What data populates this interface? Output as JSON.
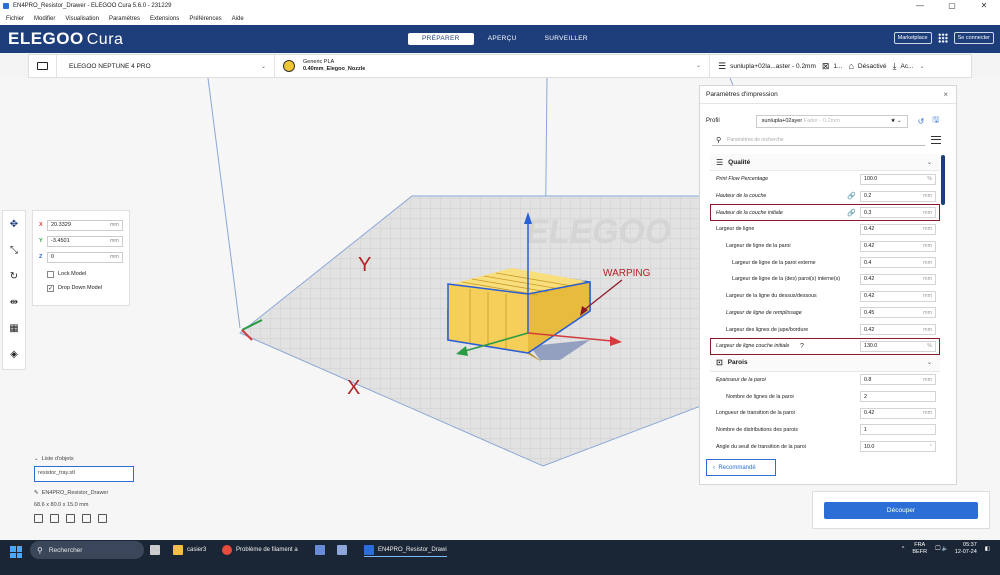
{
  "window": {
    "title": "EN4PRO_Resistor_Drawer - ELEGOO Cura 5.6.0 - 231229",
    "controls": [
      "—",
      "▢",
      "✕"
    ]
  },
  "menu": [
    "Fichier",
    "Modifier",
    "Visualisation",
    "Paramètres",
    "Extensions",
    "Préférences",
    "Aide"
  ],
  "header": {
    "logo": "ELEGOO",
    "logo_product": "Cura",
    "tabs": [
      "PRÉPARER",
      "APERÇU",
      "SURVEILLER"
    ],
    "marketplace": "Marketplace",
    "login": "Se connecter"
  },
  "toolbar": {
    "printer": "ELEGOO NEPTUNE 4 PRO",
    "material_line1": "Generic PLA",
    "material_line2": "0.40mm_Elegoo_Nozzle",
    "profile_summary": "sunlupla+02la...aster - 0.2mm",
    "support_value": "1...",
    "adhesion_label": "Désactivé",
    "extra_label": "Ac..."
  },
  "viewport": {
    "axis_x": "X",
    "axis_y": "Y",
    "brand_watermark": "ELEGOO",
    "warping_label": "WARPING"
  },
  "move_panel": {
    "x": "20.3329",
    "y": "-3.4501",
    "z": "0",
    "unit": "mm",
    "lock_model": "Lock Model",
    "drop_down": "Drop Down Model",
    "drop_down_checked": true,
    "lock_checked": false
  },
  "objects": {
    "header": "Liste d'objets",
    "file": "resistor_tray.stl",
    "project": "EN4PRO_Resistor_Drawer",
    "dimensions": "68.6 x 80.0 x 15.0 mm"
  },
  "settings": {
    "title": "Paramètres d'impression",
    "profile_label": "Profil",
    "profile_value": "sunlupla+02ayer",
    "profile_muted": "Fader - 0.2mm",
    "search_placeholder": "Paramètres de recherche",
    "quality_section": "Qualité",
    "walls_section": "Parois",
    "rows": [
      {
        "label": "Print Flow Percentage",
        "value": "100.0",
        "unit": "%",
        "italic": true,
        "level": 0
      },
      {
        "label": "Hauteur de la couche",
        "value": "0.2",
        "unit": "mm",
        "italic": true,
        "level": 0,
        "link": true
      },
      {
        "label": "Hauteur de la couche initiale",
        "value": "0.3",
        "unit": "mm",
        "italic": true,
        "level": 0,
        "link": true,
        "highlight": true
      },
      {
        "label": "Largeur de ligne",
        "value": "0.42",
        "unit": "mm",
        "italic": false,
        "level": 0
      },
      {
        "label": "Largeur de ligne de la paroi",
        "value": "0.42",
        "unit": "mm",
        "italic": false,
        "level": 1
      },
      {
        "label": "Largeur de ligne de la paroi externe",
        "value": "0.4",
        "unit": "mm",
        "italic": false,
        "level": 2
      },
      {
        "label": "Largeur de ligne de la (des) paroi(s) interne(s)",
        "value": "0.42",
        "unit": "mm",
        "italic": false,
        "level": 2
      },
      {
        "label": "Largeur de la ligne du dessus/dessous",
        "value": "0.42",
        "unit": "mm",
        "italic": false,
        "level": 1
      },
      {
        "label": "Largeur de ligne de remplissage",
        "value": "0.45",
        "unit": "mm",
        "italic": true,
        "level": 1
      },
      {
        "label": "Largeur des lignes de jupe/bordure",
        "value": "0.42",
        "unit": "mm",
        "italic": false,
        "level": 1
      },
      {
        "label": "Largeur de ligne couche initiale",
        "value": "130.0",
        "unit": "%",
        "italic": true,
        "level": 0,
        "highlight": true,
        "question": "?"
      }
    ],
    "wall_rows": [
      {
        "label": "Épaisseur de la paroi",
        "value": "0.8",
        "unit": "mm",
        "italic": true,
        "level": 0
      },
      {
        "label": "Nombre de lignes de la paroi",
        "value": "2",
        "unit": "",
        "italic": false,
        "level": 1
      },
      {
        "label": "Longueur de transition de la paroi",
        "value": "0.42",
        "unit": "mm",
        "italic": false,
        "level": 0
      },
      {
        "label": "Nombre de distributions des parois",
        "value": "1",
        "unit": "",
        "italic": false,
        "level": 0
      },
      {
        "label": "Angle du seuil de transition de la paroi",
        "value": "10.0",
        "unit": "°",
        "italic": false,
        "level": 0
      }
    ],
    "recommended": "Recommandé"
  },
  "slice": {
    "button": "Découper"
  },
  "taskbar": {
    "search": "Rechercher",
    "items": [
      "casier3",
      "Problème de filament a",
      "EN4PRO_Resistor_Drawi"
    ],
    "lang1": "FRA",
    "lang2": "BEFR",
    "time": "05:37",
    "date": "12-07-24"
  },
  "colors": {
    "brand": "#1e3d7b",
    "accent": "#2b6fd6",
    "highlight": "#8a1a2a",
    "model": "#f5cf5a"
  }
}
